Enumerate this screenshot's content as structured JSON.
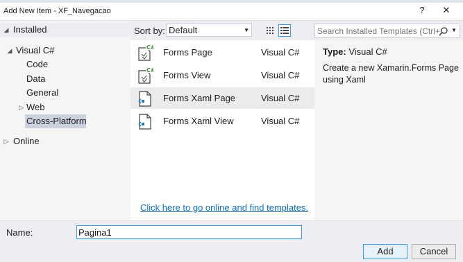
{
  "window": {
    "title": "Add New Item - XF_Navegacao",
    "help_label": "?",
    "close_label": "✕"
  },
  "tree": {
    "installed": "Installed",
    "visual_csharp": "Visual C#",
    "children": [
      "Code",
      "Data",
      "General",
      "Web",
      "Cross-Platform"
    ],
    "online": "Online"
  },
  "toolbar": {
    "sort_label": "Sort by:",
    "sort_value": "Default",
    "search_placeholder": "Search Installed Templates (Ctrl+E)"
  },
  "templates": [
    {
      "name": "Forms Page",
      "lang": "Visual C#"
    },
    {
      "name": "Forms View",
      "lang": "Visual C#"
    },
    {
      "name": "Forms Xaml Page",
      "lang": "Visual C#"
    },
    {
      "name": "Forms Xaml View",
      "lang": "Visual C#"
    }
  ],
  "online_link": "Click here to go online and find templates.",
  "details": {
    "type_label": "Type:",
    "type_value": "Visual C#",
    "description": "Create a new Xamarin.Forms Page using Xaml"
  },
  "footer": {
    "name_label": "Name:",
    "name_value": "Pagina1",
    "add_label": "Add",
    "cancel_label": "Cancel"
  }
}
